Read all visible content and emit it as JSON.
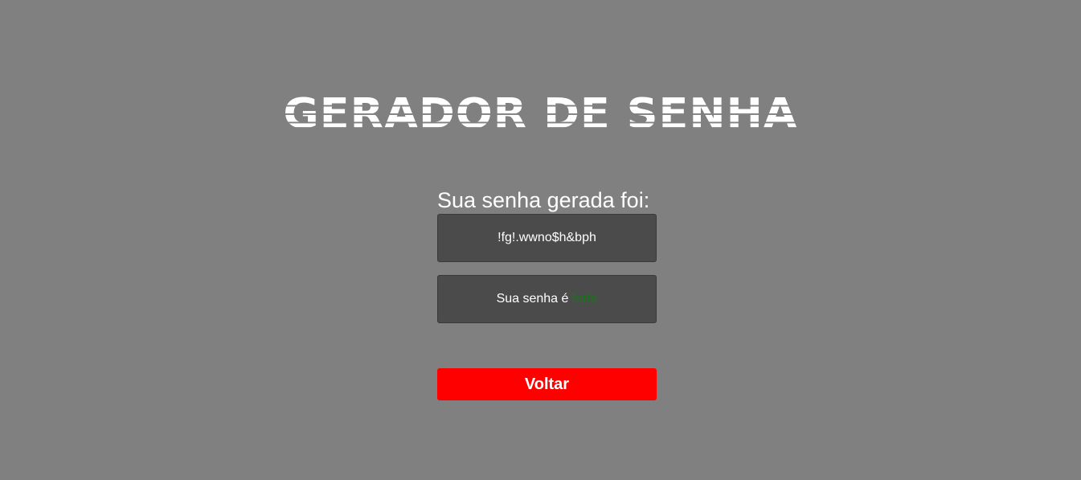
{
  "header": {
    "title": "GERADOR DE SENHA"
  },
  "result": {
    "label": "Sua senha gerada foi:",
    "password": "!fg!.wwno$h&bph",
    "strength_prefix": "Sua senha é",
    "strength_value": "forte",
    "strength_color": "#0f7a0f"
  },
  "actions": {
    "back_label": "Voltar",
    "back_color": "#ff0000"
  },
  "theme": {
    "background": "#808080",
    "box_background": "#4b4b4b"
  }
}
